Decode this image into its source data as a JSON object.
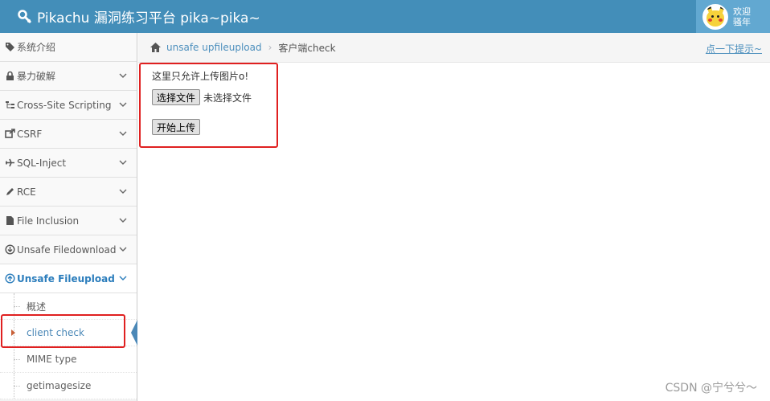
{
  "header": {
    "title": "Pikachu 漏洞练习平台 pika~pika~",
    "user_line1": "欢迎",
    "user_line2": "骚年"
  },
  "sidebar": {
    "items": [
      {
        "label": "系统介绍",
        "icon": "tags-icon"
      },
      {
        "label": "暴力破解",
        "icon": "lock-icon"
      },
      {
        "label": "Cross-Site Scripting",
        "icon": "sitemap-icon"
      },
      {
        "label": "CSRF",
        "icon": "share-icon"
      },
      {
        "label": "SQL-Inject",
        "icon": "plane-icon"
      },
      {
        "label": "RCE",
        "icon": "pencil-icon"
      },
      {
        "label": "File Inclusion",
        "icon": "file-icon"
      },
      {
        "label": "Unsafe Filedownload",
        "icon": "download-icon"
      },
      {
        "label": "Unsafe Fileupload",
        "icon": "upload-icon"
      }
    ],
    "subitems": [
      {
        "label": "概述"
      },
      {
        "label": "client check"
      },
      {
        "label": "MIME type"
      },
      {
        "label": "getimagesize"
      }
    ]
  },
  "breadcrumb": {
    "section": "unsafe upfileupload",
    "current": "客户端check",
    "hint": "点一下提示~"
  },
  "main": {
    "prompt": "这里只允许上传图片o!",
    "choose_button": "选择文件",
    "file_status": "未选择文件",
    "upload_button": "开始上传"
  },
  "watermark": "CSDN @宁兮兮～",
  "colors": {
    "header": "#438eb9",
    "accent": "#2b7dbc",
    "annotation": "#e02020"
  }
}
